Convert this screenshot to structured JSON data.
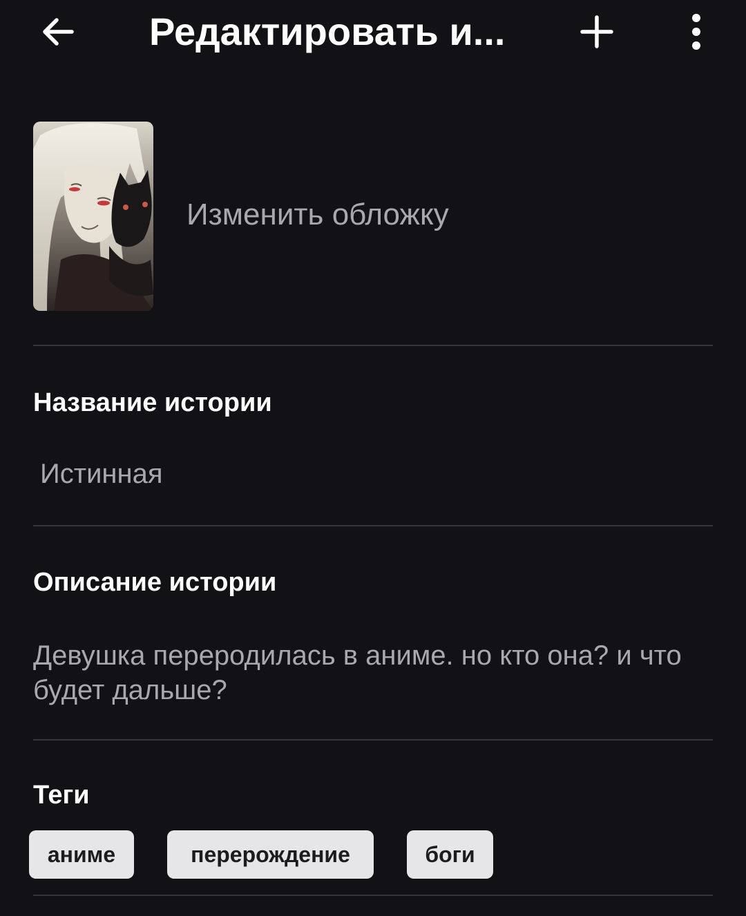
{
  "header": {
    "title": "Редактировать и...",
    "back_icon": "arrow-left-icon",
    "add_icon": "plus-icon",
    "more_icon": "more-vertical-icon"
  },
  "cover": {
    "change_label": "Изменить обложку"
  },
  "story": {
    "title_label": "Название истории",
    "title_value": "Истинная",
    "description_label": "Описание истории",
    "description_value": "Девушка переродилась в аниме. но кто она? и что будет дальше?",
    "tags_label": "Теги",
    "tags": [
      "аниме",
      "перерождение",
      "боги"
    ]
  },
  "colors": {
    "background": "#121115",
    "divider": "#36353a",
    "muted_text": "#a9a9ad",
    "tag_background": "#e6e6e8",
    "tag_text": "#1c1c1e"
  }
}
